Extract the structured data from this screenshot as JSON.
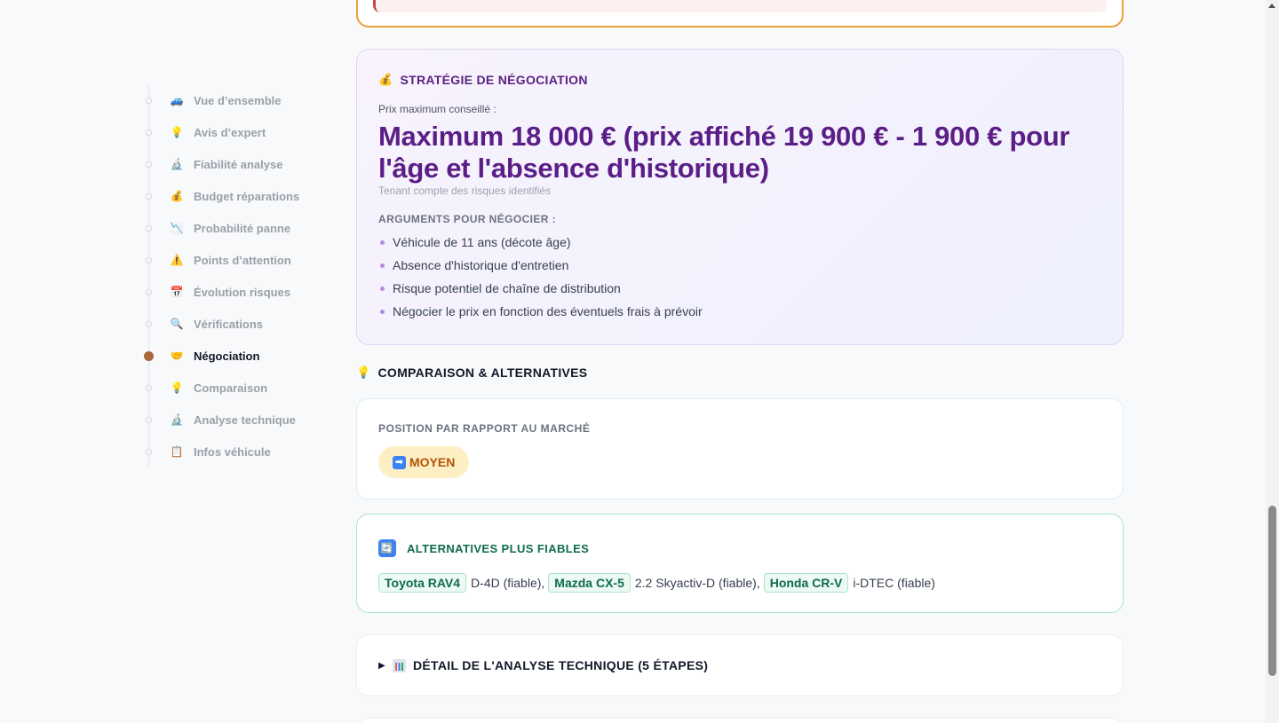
{
  "sidebar": {
    "items": [
      {
        "icon": "🚙",
        "label": "Vue d’ensemble",
        "active": false
      },
      {
        "icon": "💡",
        "label": "Avis d’expert",
        "active": false
      },
      {
        "icon": "🔬",
        "label": "Fiabilité analyse",
        "active": false
      },
      {
        "icon": "💰",
        "label": "Budget réparations",
        "active": false
      },
      {
        "icon": "📉",
        "label": "Probabilité panne",
        "active": false
      },
      {
        "icon": "⚠️",
        "label": "Points d’attention",
        "active": false
      },
      {
        "icon": "📅",
        "label": "Évolution risques",
        "active": false
      },
      {
        "icon": "🔍",
        "label": "Vérifications",
        "active": false
      },
      {
        "icon": "🤝",
        "label": "Négociation",
        "active": true
      },
      {
        "icon": "💡",
        "label": "Comparaison",
        "active": false
      },
      {
        "icon": "🔬",
        "label": "Analyse technique",
        "active": false
      },
      {
        "icon": "📋",
        "label": "Infos véhicule",
        "active": false
      }
    ]
  },
  "negotiation": {
    "icon": "💰",
    "title": "STRATÉGIE DE NÉGOCIATION",
    "price_label": "Prix maximum conseillé :",
    "price_value": "Maximum 18 000 € (prix affiché 19 900 € - 1 900 € pour l'âge et l'absence d'historique)",
    "price_note": "Tenant compte des risques identifiés",
    "arguments_title": "ARGUMENTS POUR NÉGOCIER :",
    "arguments": [
      "Véhicule de 11 ans (décote âge)",
      "Absence d'historique d'entretien",
      "Risque potentiel de chaîne de distribution",
      "Négocier le prix en fonction des éventuels frais à prévoir"
    ]
  },
  "comparison": {
    "icon": "💡",
    "title": "COMPARAISON & ALTERNATIVES",
    "market": {
      "title": "POSITION PAR RAPPORT AU MARCHÉ",
      "badge_icon": "➡",
      "badge": "MOYEN"
    },
    "alternatives": {
      "icon": "🔄",
      "title": "ALTERNATIVES PLUS FIABLES",
      "items": [
        {
          "model": "Toyota RAV4",
          "detail": "D-4D (fiable),"
        },
        {
          "model": "Mazda CX-5",
          "detail": "2.2 Skyactiv-D (fiable),"
        },
        {
          "model": "Honda CR-V",
          "detail": "i-DTEC (fiable)"
        }
      ]
    }
  },
  "details": {
    "toggle": "▶",
    "title": "DÉTAIL DE L'ANALYSE TECHNIQUE (5 ÉTAPES)"
  },
  "colors": {
    "accent_purple": "#5b1e86",
    "active_dot": "#a8673c",
    "alert_border": "#e8a33a",
    "alt_green": "#0f6b4f",
    "badge_bg": "#fcefc4"
  }
}
